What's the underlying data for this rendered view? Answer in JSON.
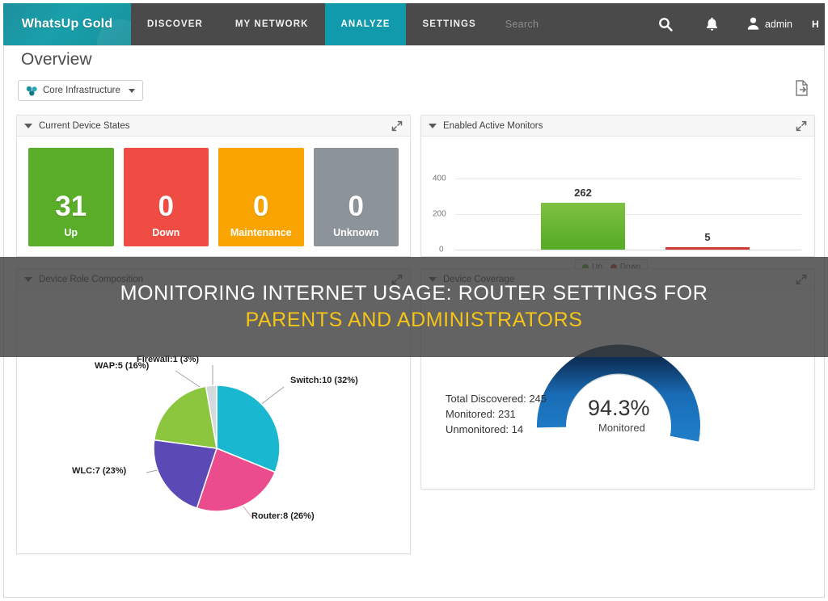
{
  "navbar": {
    "brand": "WhatsUp Gold",
    "items": [
      {
        "label": "DISCOVER",
        "active": false
      },
      {
        "label": "MY NETWORK",
        "active": false
      },
      {
        "label": "ANALYZE",
        "active": true
      },
      {
        "label": "SETTINGS",
        "active": false
      }
    ],
    "search_placeholder": "Search",
    "user": "admin",
    "help": "H",
    "active_tab_color": "#109aab",
    "bar_color": "#4a4a4a"
  },
  "page": {
    "title": "Overview",
    "scope_button": "Core Infrastructure"
  },
  "panels": {
    "device_states": {
      "title": "Current Device States",
      "tiles": [
        {
          "value": "31",
          "label": "Up",
          "color": "#5aad28"
        },
        {
          "value": "0",
          "label": "Down",
          "color": "#ef4d43"
        },
        {
          "value": "0",
          "label": "Maintenance",
          "color": "#f9a400"
        },
        {
          "value": "0",
          "label": "Unknown",
          "color": "#8c9399"
        }
      ]
    },
    "active_monitors": {
      "title": "Enabled Active Monitors"
    },
    "role_composition": {
      "title": "Device Role Composition"
    },
    "device_coverage": {
      "title": "Device Coverage",
      "percent": "94.3%",
      "percent_label": "Monitored",
      "stats": {
        "total_discovered": "Total Discovered: 245",
        "monitored": "Monitored: 231",
        "unmonitored": "Unmonitored: 14"
      },
      "arc_color": "#1b6cb5",
      "track_color": "#c9d4d6"
    }
  },
  "overlay": {
    "line1": "MONITORING INTERNET USAGE: ROUTER SETTINGS FOR",
    "line2": "PARENTS AND ADMINISTRATORS"
  },
  "chart_data": [
    {
      "type": "bar",
      "title": "Enabled Active Monitors",
      "categories": [
        "Up",
        "Down"
      ],
      "values": [
        262,
        5
      ],
      "colors": [
        "#5aad28",
        "#cf3a32"
      ],
      "ylabel": "",
      "xlabel": "",
      "ylim": [
        0,
        450
      ],
      "yticks": [
        0,
        200,
        400
      ],
      "ytick_labels": [
        "0",
        "200",
        "400"
      ],
      "grid": true,
      "legend": [
        "Up",
        "Down"
      ],
      "legend_position": "bottom-center",
      "data_labels": [
        "262",
        "5"
      ]
    },
    {
      "type": "pie",
      "title": "Device Role Composition",
      "categories": [
        "Switch",
        "Router",
        "WLC",
        "WAP",
        "Firewall"
      ],
      "values": [
        10,
        8,
        7,
        5,
        1
      ],
      "percents": [
        32,
        26,
        23,
        16,
        3
      ],
      "labels": [
        "Switch:10 (32%)",
        "Router:8 (26%)",
        "WLC:7 (23%)",
        "WAP:5 (16%)",
        "Firewall:1 (3%)"
      ],
      "colors": [
        "#19b8d0",
        "#ea4c8d",
        "#5b4ab5",
        "#8cc63e",
        "#d4d9dd"
      ],
      "legend_position": "callout-labels"
    },
    {
      "type": "gauge",
      "title": "Device Coverage",
      "value": 94.3,
      "unit": "%",
      "value_label": "94.3%",
      "sub_label": "Monitored",
      "ylim": [
        0,
        100
      ],
      "annotations": [
        "Total Discovered: 245",
        "Monitored: 231",
        "Unmonitored: 14"
      ]
    }
  ]
}
